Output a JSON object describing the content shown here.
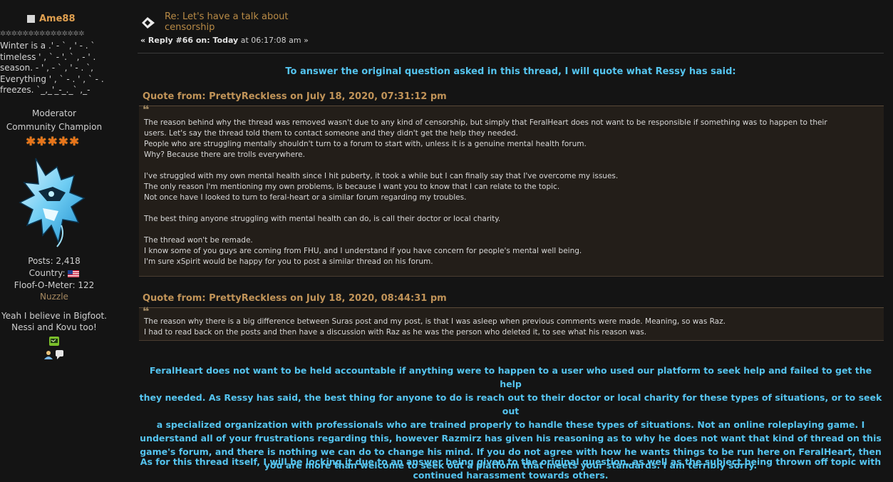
{
  "user": {
    "name": "Ame88",
    "stars_line": "✲✲✲✲✲✲✲✲✲✲✲✲✲✲✲",
    "signature_poem": "Winter is a .' - ` , ' - . `\ntimeless ' , ` - '. ` , - ' .\nseason. - ' , - ` , ' - . `,\nEverything ' , ` - . ' , ` - .\nfreezes. `_,_'_-_._` ,_-",
    "title": "Moderator",
    "group": "Community Champion",
    "rank_stars": 5,
    "posts": "Posts: 2,418",
    "country": "Country:",
    "floof": "Floof-O-Meter: 122",
    "nuzzle": "Nuzzle",
    "personal_text_1": "Yeah I believe in Bigfoot.",
    "personal_text_2": "Nessi and Kovu too!"
  },
  "post": {
    "title": "Re: Let's have a talk about censorship",
    "reply_label": "« Reply #66 on: Today",
    "time": "at 06:17:08 am »",
    "intro": "To answer the original question asked in this thread, I will quote what Ressy has said:"
  },
  "quotes": [
    {
      "header": "Quote from: PrettyReckless on July 18, 2020, 07:31:12 pm",
      "lines": [
        "The reason behind why the thread was removed wasn't due to any kind of censorship, but simply that FeralHeart does not want to be responsible if something was to happen to their",
        "users. Let's say the thread told them to contact someone and they didn't get the help they needed.",
        "People who are struggling mentally shouldn't turn to a forum to start with, unless it is a genuine mental health forum.",
        "Why? Because there are trolls everywhere.",
        "",
        "I've struggled with my own mental health since I hit puberty, it took a while but I can finally say that I've overcome my issues.",
        "The only reason I'm mentioning my own problems, is because I want you to know that I can relate to the topic.",
        "Not once have I looked to turn to feral-heart or a similar forum regarding my troubles.",
        "",
        "The best thing anyone struggling with mental health can do, is call their doctor or local charity.",
        "",
        "The thread won't be remade.",
        "I know some of you guys are coming from FHU, and I understand if you have concern for people's mental well being.",
        "I'm sure xSpirit would be happy for you to post a similar thread on his forum."
      ]
    },
    {
      "header": "Quote from: PrettyReckless on July 18, 2020, 08:44:31 pm",
      "lines": [
        "The reason why there is a big difference between Suras post and my post, is that I was asleep when previous comments were made. Meaning, so was Raz.",
        "I had to read back on the posts and then have a discussion with Raz as he was the person who deleted it, to see what his reason was."
      ]
    }
  ],
  "closing": {
    "p1": [
      "FeralHeart does not want to be held accountable if anything were to happen to a user who used our platform to seek help and failed to get the help",
      "they needed. As Ressy has said, the best thing for anyone to do is reach out to their doctor or local charity for these types of situations, or to seek out",
      "a specialized organization with professionals who are trained properly to handle these types of situations. Not an online roleplaying game. I",
      "understand all of your frustrations regarding this, however Razmirz has given his reasoning as to why he does not want that kind of thread on this",
      "game's forum, and there is nothing we can do to change his mind. If you do not agree with how he wants things to be run here on FeralHeart, then",
      "you are more than welcome to seek out a platform that meets your standards. I am terribly sorry."
    ],
    "p2": [
      "As for this thread itself, I will be locking it due to an answer being given to the original question, as well as the subject being thrown off topic with",
      "continued harassment towards others."
    ]
  },
  "icons": {
    "status": "offline-status-icon",
    "post": "post-icon",
    "avatar": "wolf-avatar",
    "flag": "us-flag-icon",
    "personal_message": "personal-message-icon",
    "profile": "profile-icon",
    "message": "message-icon"
  },
  "colors": {
    "background": "#141414",
    "username": "#e0a050",
    "accent_text": "#55c4ef",
    "quote_header": "#c09358",
    "quote_bg": "#231e19"
  }
}
